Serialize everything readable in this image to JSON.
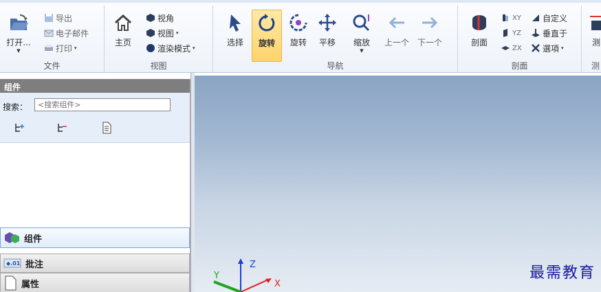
{
  "ribbon": {
    "file": {
      "label": "文件",
      "open": "打开...",
      "export": "导出",
      "email": "电子邮件",
      "print": "打印"
    },
    "view": {
      "label": "视图",
      "home": "主页",
      "angle": "视角",
      "views": "视图",
      "render_mode": "渲染模式"
    },
    "nav": {
      "label": "导航",
      "select": "选择",
      "rotate_active": "旋转",
      "rotate": "旋转",
      "pan": "平移",
      "zoom": "缩放",
      "prev": "上一个",
      "next": "下一个"
    },
    "section": {
      "label": "剖面",
      "section": "剖面",
      "xy": "XY",
      "yz": "YZ",
      "zx": "ZX",
      "custom": "自定义",
      "perpendicular": "垂直于",
      "options": "選項"
    },
    "measure": {
      "label": "测",
      "btn": "测"
    }
  },
  "panel": {
    "title": "组件",
    "search_label": "搜索：",
    "search_placeholder": "<搜索组件>",
    "tabs": [
      "组件",
      "批注",
      "属性"
    ]
  },
  "viewport": {
    "watermark": "最需教育",
    "axes": {
      "x": "X",
      "y": "Y",
      "z": "Z"
    }
  },
  "colors": {
    "accent": "#fdd46b",
    "axis_x": "#e0201e",
    "axis_y": "#1fa31f",
    "axis_z": "#1a3fd8",
    "watermark": "#1a1aa0"
  }
}
